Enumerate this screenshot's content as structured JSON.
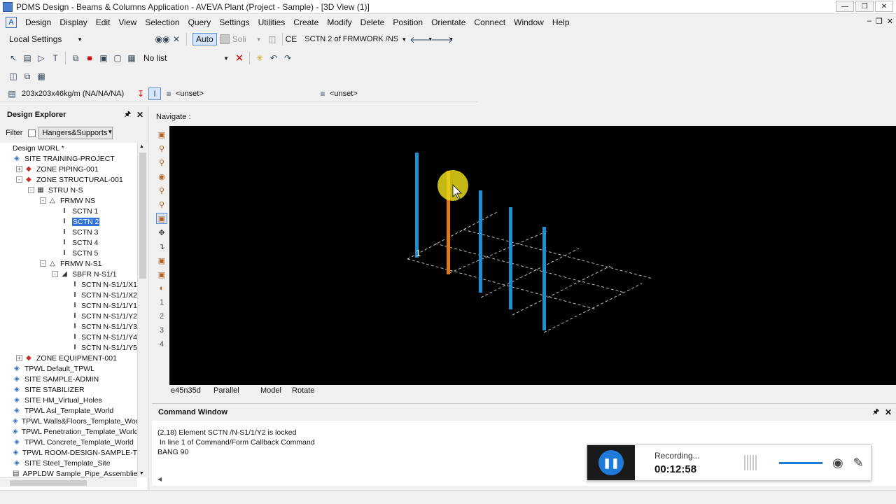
{
  "window": {
    "title": "PDMS Design - Beams & Columns Application - AVEVA Plant (Project - Sample) - [3D View (1)]",
    "controls": [
      "minimize-icon",
      "maximize-icon",
      "close-icon"
    ]
  },
  "menu": [
    "Design",
    "Display",
    "Edit",
    "View",
    "Selection",
    "Query",
    "Settings",
    "Utilities",
    "Create",
    "Modify",
    "Delete",
    "Position",
    "Orientate",
    "Connect",
    "Window",
    "Help"
  ],
  "toolbar1": {
    "settings": "Local Settings",
    "auto_label": "Auto",
    "solid_label": "Soli",
    "ce_label": "CE",
    "ce_value": "SCTN 2 of FRMWORK /NS"
  },
  "toolbar2": {
    "list_value": "No list"
  },
  "toolbar4": {
    "profile_spec": "203x203x46kg/m (NA/NA/NA)",
    "unset_1": "<unset>",
    "unset_2": "<unset>"
  },
  "explorer": {
    "title": "Design Explorer",
    "filter_label": "Filter",
    "filter_value": "Hangers&Supports",
    "tree": [
      {
        "label": "Design WORL *",
        "depth": 0,
        "icon": "none",
        "exp": ""
      },
      {
        "label": "SITE TRAINING-PROJECT",
        "depth": 0,
        "icon": "site",
        "exp": ""
      },
      {
        "label": "ZONE PIPING-001",
        "depth": 1,
        "icon": "zone",
        "exp": "+"
      },
      {
        "label": "ZONE STRUCTURAL-001",
        "depth": 1,
        "icon": "zone",
        "exp": "-"
      },
      {
        "label": "STRU N-S",
        "depth": 2,
        "icon": "stru",
        "exp": "-"
      },
      {
        "label": "FRMW NS",
        "depth": 3,
        "icon": "frmw",
        "exp": "-"
      },
      {
        "label": "SCTN 1",
        "depth": 4,
        "icon": "beam",
        "exp": ""
      },
      {
        "label": "SCTN 2",
        "depth": 4,
        "icon": "beam",
        "exp": "",
        "selected": true
      },
      {
        "label": "SCTN 3",
        "depth": 4,
        "icon": "beam",
        "exp": ""
      },
      {
        "label": "SCTN 4",
        "depth": 4,
        "icon": "beam",
        "exp": ""
      },
      {
        "label": "SCTN 5",
        "depth": 4,
        "icon": "beam",
        "exp": ""
      },
      {
        "label": "FRMW N-S1",
        "depth": 3,
        "icon": "frmw",
        "exp": "-"
      },
      {
        "label": "SBFR N-S1/1",
        "depth": 4,
        "icon": "sbfr",
        "exp": "-"
      },
      {
        "label": "SCTN N-S1/1/X1",
        "depth": 5,
        "icon": "beam",
        "exp": ""
      },
      {
        "label": "SCTN N-S1/1/X2",
        "depth": 5,
        "icon": "beam",
        "exp": ""
      },
      {
        "label": "SCTN N-S1/1/Y1",
        "depth": 5,
        "icon": "beam",
        "exp": ""
      },
      {
        "label": "SCTN N-S1/1/Y2",
        "depth": 5,
        "icon": "beam",
        "exp": ""
      },
      {
        "label": "SCTN N-S1/1/Y3",
        "depth": 5,
        "icon": "beam",
        "exp": ""
      },
      {
        "label": "SCTN N-S1/1/Y4",
        "depth": 5,
        "icon": "beam",
        "exp": ""
      },
      {
        "label": "SCTN N-S1/1/Y5",
        "depth": 5,
        "icon": "beam",
        "exp": ""
      },
      {
        "label": "ZONE EQUIPMENT-001",
        "depth": 1,
        "icon": "zone",
        "exp": "+"
      },
      {
        "label": "TPWL Default_TPWL",
        "depth": 0,
        "icon": "site",
        "exp": ""
      },
      {
        "label": "SITE SAMPLE-ADMIN",
        "depth": 0,
        "icon": "site",
        "exp": ""
      },
      {
        "label": "SITE STABILIZER",
        "depth": 0,
        "icon": "site",
        "exp": ""
      },
      {
        "label": "SITE HM_Virtual_Holes",
        "depth": 0,
        "icon": "site",
        "exp": ""
      },
      {
        "label": "TPWL Asl_Template_World",
        "depth": 0,
        "icon": "site",
        "exp": ""
      },
      {
        "label": "TPWL Walls&Floors_Template_Worl",
        "depth": 0,
        "icon": "site",
        "exp": ""
      },
      {
        "label": "TPWL Penetration_Template_World",
        "depth": 0,
        "icon": "site",
        "exp": ""
      },
      {
        "label": "TPWL Concrete_Template_World",
        "depth": 0,
        "icon": "site",
        "exp": ""
      },
      {
        "label": "TPWL ROOM-DESIGN-SAMPLE-T",
        "depth": 0,
        "icon": "site",
        "exp": ""
      },
      {
        "label": "SITE Steel_Template_Site",
        "depth": 0,
        "icon": "site",
        "exp": ""
      },
      {
        "label": "APPLDW Sample_Pipe_Assemblies",
        "depth": 0,
        "icon": "appl",
        "exp": ""
      }
    ]
  },
  "view3d": {
    "nav_label": "Navigate :",
    "member_label": "1",
    "status": [
      "e45n35d",
      "Parallel",
      "Model",
      "Rotate"
    ],
    "colors": {
      "background": "#000000",
      "member": "#1e90d0",
      "selected": "#e07818",
      "grid": "#bbbbbb",
      "cursor_halo": "#e8d818"
    }
  },
  "command_window": {
    "title": "Command Window",
    "lines": [
      "(2,18) Element SCTN /N-S1/1/Y2 is locked",
      " In line 1 of Command/Form Callback Command",
      "BANG 90"
    ]
  },
  "recorder": {
    "status": "Recording...",
    "time": "00:12:58"
  }
}
